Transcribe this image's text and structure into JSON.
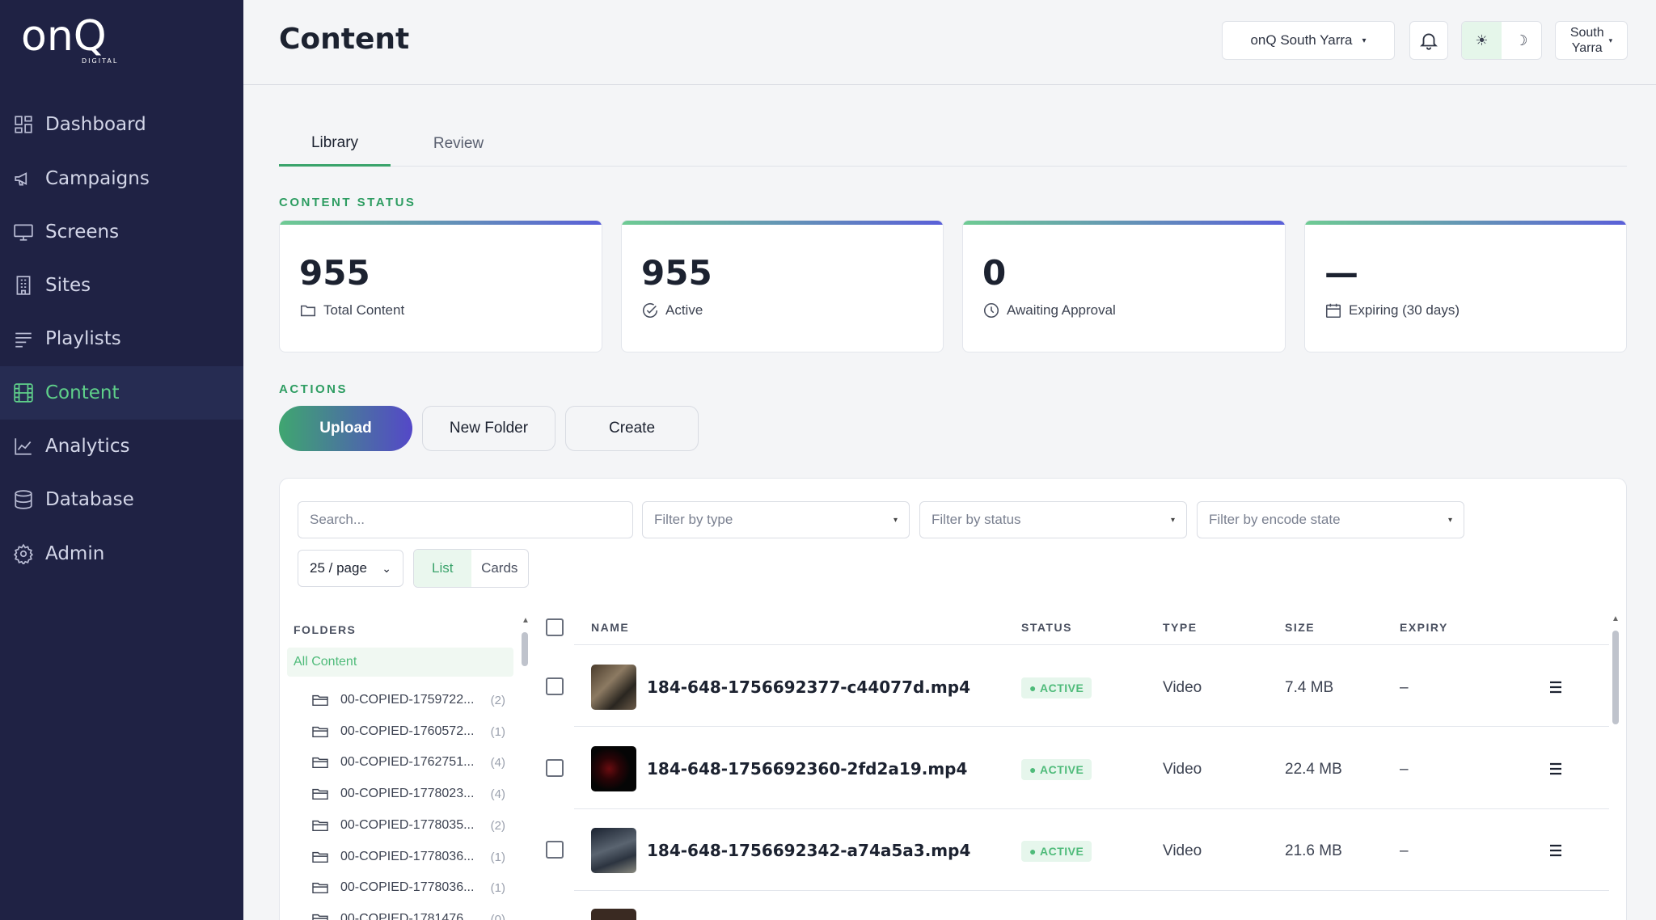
{
  "app": {
    "logo_text": "onQ",
    "logo_sub": "DIGITAL"
  },
  "sidebar": {
    "items": [
      {
        "label": "Dashboard",
        "icon": "dashboard-icon"
      },
      {
        "label": "Campaigns",
        "icon": "megaphone-icon"
      },
      {
        "label": "Screens",
        "icon": "monitor-icon"
      },
      {
        "label": "Sites",
        "icon": "building-icon"
      },
      {
        "label": "Playlists",
        "icon": "playlist-icon"
      },
      {
        "label": "Content",
        "icon": "film-icon",
        "active": true
      },
      {
        "label": "Analytics",
        "icon": "chart-line-icon"
      },
      {
        "label": "Database",
        "icon": "database-icon"
      },
      {
        "label": "Admin",
        "icon": "gear-icon"
      }
    ]
  },
  "header": {
    "title": "Content",
    "site_select": "onQ South Yarra",
    "theme_light": "☀",
    "theme_dark": "☽",
    "user_line1": "South",
    "user_line2": "Yarra"
  },
  "tabs": {
    "library": "Library",
    "review": "Review"
  },
  "content_status": {
    "label": "CONTENT STATUS",
    "cards": [
      {
        "value": "955",
        "label": "Total Content",
        "icon": "folder-icon"
      },
      {
        "value": "955",
        "label": "Active",
        "icon": "check-circle-icon"
      },
      {
        "value": "0",
        "label": "Awaiting Approval",
        "icon": "clock-icon"
      },
      {
        "value": "—",
        "label": "Expiring (30 days)",
        "icon": "calendar-icon"
      }
    ]
  },
  "actions": {
    "label": "ACTIONS",
    "upload": "Upload",
    "new_folder": "New Folder",
    "create": "Create"
  },
  "filters": {
    "search_placeholder": "Search...",
    "type_placeholder": "Filter by type",
    "status_placeholder": "Filter by status",
    "encode_placeholder": "Filter by encode state",
    "per_page": "25 / page",
    "per_page_options": [
      "25 / page"
    ],
    "view_list": "List",
    "view_cards": "Cards"
  },
  "folders": {
    "header": "FOLDERS",
    "all": "All Content",
    "items": [
      {
        "name": "00-COPIED-1759722...",
        "count": "(2)"
      },
      {
        "name": "00-COPIED-1760572...",
        "count": "(1)"
      },
      {
        "name": "00-COPIED-1762751...",
        "count": "(4)"
      },
      {
        "name": "00-COPIED-1778023...",
        "count": "(4)"
      },
      {
        "name": "00-COPIED-1778035...",
        "count": "(2)"
      },
      {
        "name": "00-COPIED-1778036...",
        "count": "(1)"
      },
      {
        "name": "00-COPIED-1778036...",
        "count": "(1)"
      },
      {
        "name": "00-COPIED-1781476...",
        "count": "(0)"
      }
    ]
  },
  "table": {
    "headers": {
      "name": "NAME",
      "status": "STATUS",
      "type": "TYPE",
      "size": "SIZE",
      "expiry": "EXPIRY"
    },
    "rows": [
      {
        "name": "184-648-1756692377-c44077d.mp4",
        "status": "ACTIVE",
        "type": "Video",
        "size": "7.4 MB",
        "expiry": "–"
      },
      {
        "name": "184-648-1756692360-2fd2a19.mp4",
        "status": "ACTIVE",
        "type": "Video",
        "size": "22.4 MB",
        "expiry": "–"
      },
      {
        "name": "184-648-1756692342-a74a5a3.mp4",
        "status": "ACTIVE",
        "type": "Video",
        "size": "21.6 MB",
        "expiry": "–"
      }
    ]
  },
  "colors": {
    "sidebar_bg": "#1f2244",
    "accent_green": "#3aa36b",
    "accent_purple": "#5448c8"
  }
}
